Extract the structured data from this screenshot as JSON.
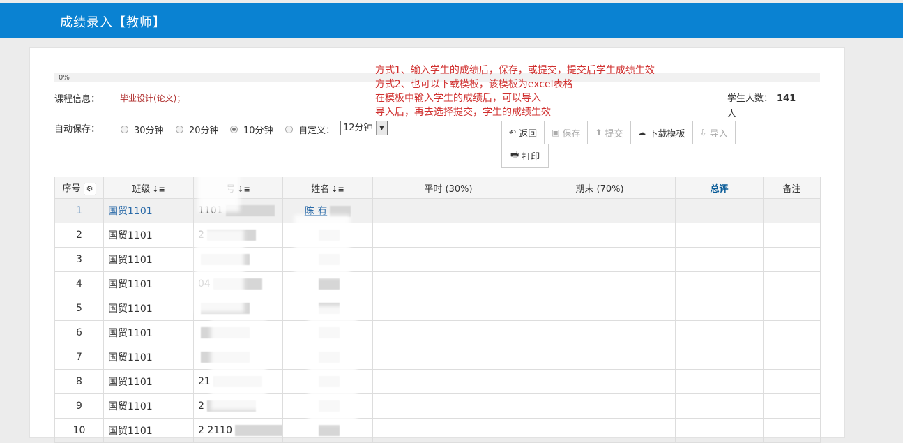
{
  "header": {
    "title": "成绩录入【教师】"
  },
  "progress": {
    "text": "0%",
    "value": 0
  },
  "course": {
    "label": "课程信息：",
    "value": "毕业设计(论文)；"
  },
  "students": {
    "label": "学生人数：",
    "count": "141",
    "unit": "人"
  },
  "note": [
    "方式1、输入学生的成绩后，保存，或提交，提交后学生成绩生效",
    "方式2、也可以下载模板，该模板为excel表格",
    "在模板中输入学生的成绩后，可以导入",
    "导入后，再去选择提交，学生的成绩生效"
  ],
  "autosave": {
    "label": "自动保存：",
    "options": [
      "30分钟",
      "20分钟",
      "10分钟",
      "自定义："
    ],
    "selected_index": 2,
    "custom_value": "12分钟"
  },
  "buttons": {
    "back": "返回",
    "save": "保存",
    "submit": "提交",
    "download": "下载模板",
    "import": "导入",
    "print": "打印"
  },
  "table": {
    "headers": [
      "序号",
      "班级",
      "号",
      "姓名",
      "平时 (30%)",
      "期末 (70%)",
      "总评",
      "备注"
    ],
    "rows": [
      {
        "no": "1",
        "cls": "国贸1101",
        "sid": "1101",
        "name": "陈 有"
      },
      {
        "no": "2",
        "cls": "国贸1101",
        "sid": "2",
        "name": ""
      },
      {
        "no": "3",
        "cls": "国贸1101",
        "sid": "",
        "name": ""
      },
      {
        "no": "4",
        "cls": "国贸1101",
        "sid": "04",
        "name": ""
      },
      {
        "no": "5",
        "cls": "国贸1101",
        "sid": "",
        "name": ""
      },
      {
        "no": "6",
        "cls": "国贸1101",
        "sid": "",
        "name": ""
      },
      {
        "no": "7",
        "cls": "国贸1101",
        "sid": "",
        "name": ""
      },
      {
        "no": "8",
        "cls": "国贸1101",
        "sid": "21",
        "name": ""
      },
      {
        "no": "9",
        "cls": "国贸1101",
        "sid": "2",
        "name": ""
      },
      {
        "no": "10",
        "cls": "国贸1101",
        "sid": "2  2110",
        "name": ""
      }
    ]
  }
}
